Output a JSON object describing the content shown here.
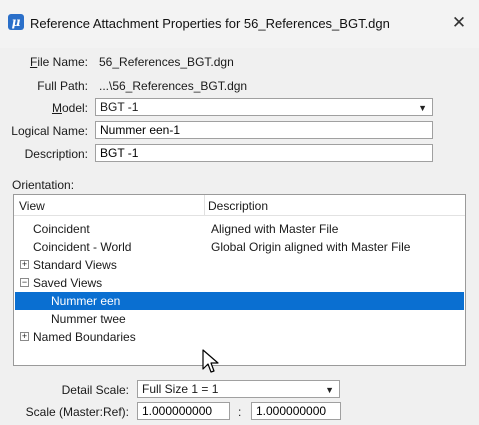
{
  "window": {
    "title": "Reference Attachment Properties for 56_References_BGT.dgn",
    "app_icon_glyph": "μ",
    "close_glyph": "✕"
  },
  "fields": {
    "file_name": {
      "label_ul": "F",
      "label_rest": "ile Name:",
      "value": "56_References_BGT.dgn"
    },
    "full_path": {
      "label": "Full Path:",
      "value": "...\\56_References_BGT.dgn"
    },
    "model": {
      "label_ul": "M",
      "label_rest": "odel:",
      "value": "BGT -1"
    },
    "logical_name": {
      "label": "Logical Name:",
      "value": "Nummer een-1"
    },
    "description": {
      "label": "Description:",
      "value": "BGT -1"
    }
  },
  "orientation": {
    "label": "Orientation:",
    "columns": {
      "view": "View",
      "description": "Description"
    },
    "rows": [
      {
        "view": "Coincident",
        "description": "Aligned with Master File"
      },
      {
        "view": "Coincident - World",
        "description": "Global Origin aligned with Master File"
      },
      {
        "view": "Standard Views",
        "description": "",
        "expander": "+"
      },
      {
        "view": "Saved Views",
        "description": "",
        "expander": "−"
      },
      {
        "view": "Nummer een",
        "description": "",
        "selected": true
      },
      {
        "view": "Nummer twee",
        "description": ""
      },
      {
        "view": "Named Boundaries",
        "description": "",
        "expander": "+"
      }
    ]
  },
  "scale": {
    "detail_label": "Detail Scale:",
    "detail_value": "Full Size 1 = 1",
    "ratio_label": "Scale (Master:Ref):",
    "master_value": "1.000000000",
    "separator": ":",
    "ref_value": "1.000000000"
  },
  "colors": {
    "selection": "#0a6fd1",
    "app_icon": "#2a6fc9"
  }
}
